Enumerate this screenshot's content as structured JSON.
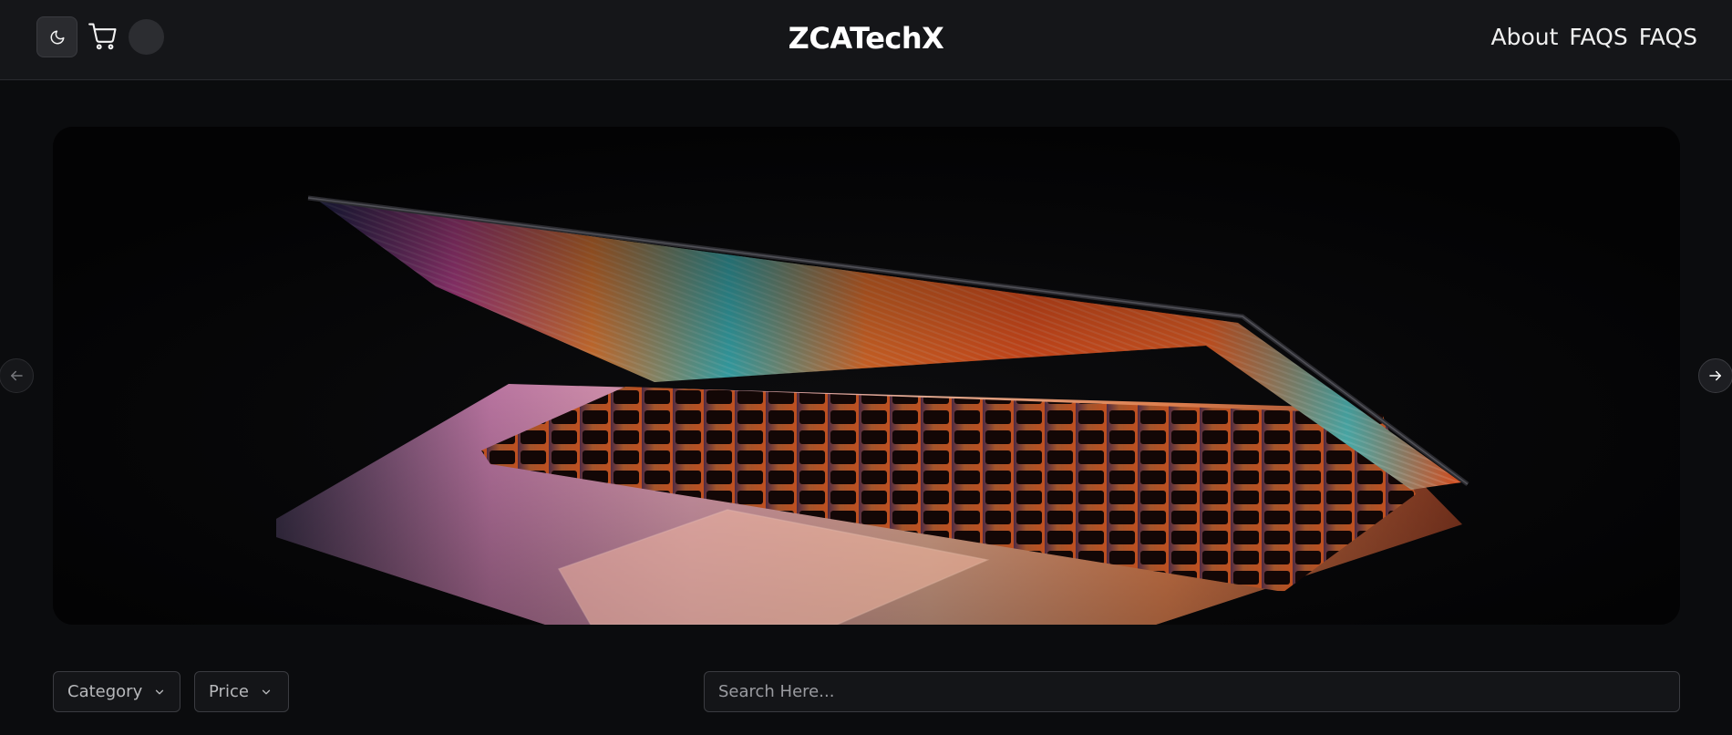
{
  "header": {
    "brand": "ZCATechX",
    "nav": [
      {
        "label": "About"
      },
      {
        "label": "FAQS"
      },
      {
        "label": "FAQS"
      }
    ],
    "icons": {
      "theme": "moon-icon",
      "cart": "cart-icon",
      "avatar": "avatar"
    }
  },
  "hero": {
    "image": "laptop-photo",
    "prev_icon": "arrow-left-icon",
    "next_icon": "arrow-right-icon"
  },
  "filters": {
    "category_label": "Category",
    "price_label": "Price"
  },
  "search": {
    "placeholder": "Search Here..."
  },
  "colors": {
    "background": "#0b0c0e",
    "header": "#151619",
    "border": "#3b3c41"
  }
}
